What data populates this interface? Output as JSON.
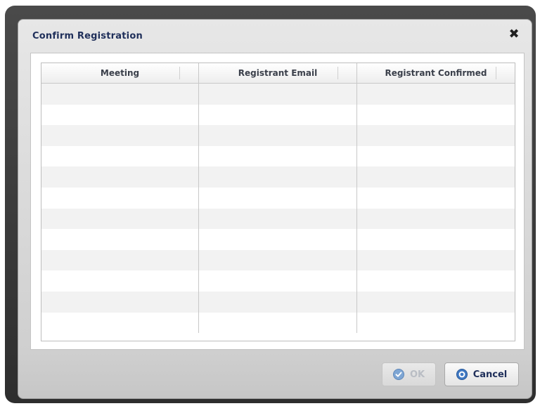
{
  "dialog": {
    "title": "Confirm Registration",
    "close_label": "✖"
  },
  "grid": {
    "columns": [
      "Meeting",
      "Registrant Email",
      "Registrant Confirmed"
    ],
    "rows": [
      [
        "",
        "",
        ""
      ],
      [
        "",
        "",
        ""
      ],
      [
        "",
        "",
        ""
      ],
      [
        "",
        "",
        ""
      ],
      [
        "",
        "",
        ""
      ],
      [
        "",
        "",
        ""
      ],
      [
        "",
        "",
        ""
      ],
      [
        "",
        "",
        ""
      ],
      [
        "",
        "",
        ""
      ],
      [
        "",
        "",
        ""
      ],
      [
        "",
        "",
        ""
      ],
      [
        "",
        "",
        ""
      ]
    ]
  },
  "buttons": {
    "ok_label": "OK",
    "cancel_label": "Cancel"
  },
  "colors": {
    "title_text": "#1f2f5a",
    "frame": "#3a3a3a",
    "ok_disabled_text": "#b9bdc4",
    "icon_blue": "#3f78c2"
  },
  "icons": {
    "ok": "checkmark-circle-icon",
    "cancel": "cancel-circle-icon",
    "close": "close-icon"
  }
}
